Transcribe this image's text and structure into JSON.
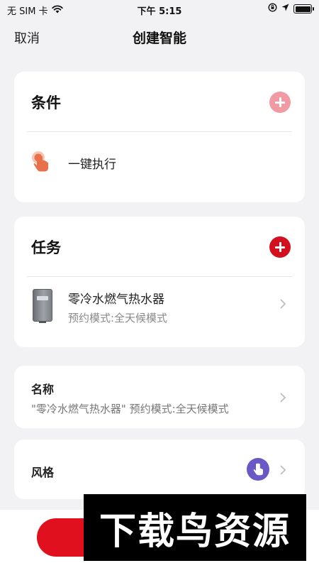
{
  "status_bar": {
    "carrier": "无 SIM 卡",
    "time": "下午 5:15"
  },
  "nav": {
    "cancel_label": "取消",
    "title": "创建智能"
  },
  "condition": {
    "title": "条件",
    "item_label": "一键执行"
  },
  "task": {
    "title": "任务",
    "device_name": "零冷水燃气热水器",
    "device_mode": "预约模式:全天候模式"
  },
  "name": {
    "label": "名称",
    "value": "\"零冷水燃气热水器\" 预约模式:全天候模式"
  },
  "style": {
    "label": "风格"
  },
  "watermark": "下载鸟资源",
  "colors": {
    "accent": "#d3101e",
    "accent_light": "#f29aa3",
    "style_avatar": "#6a58c6",
    "tap_icon": "#e8704a"
  },
  "icons": {
    "wifi": "wifi-icon",
    "lock_rotation": "lock-rotation-icon",
    "location": "location-arrow-icon",
    "tap": "hand-tap-icon",
    "add": "plus-icon",
    "chevron": "chevron-right-icon"
  }
}
